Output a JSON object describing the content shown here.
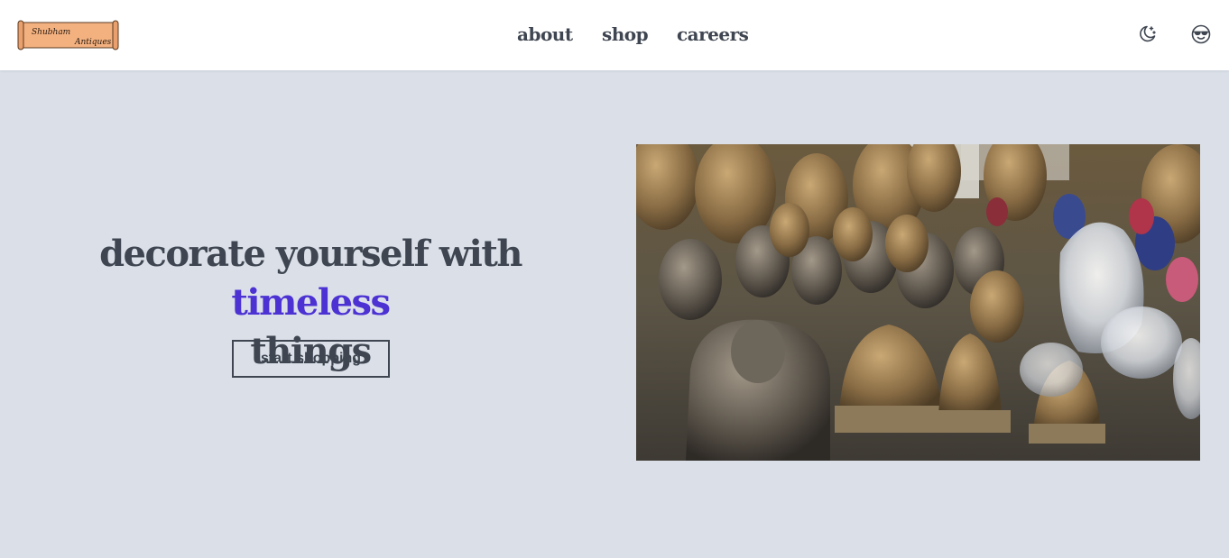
{
  "header": {
    "logo": {
      "line1": "Shubham",
      "line2": "Antiques",
      "icon": "scroll-logo"
    },
    "nav": [
      {
        "label": "about"
      },
      {
        "label": "shop"
      },
      {
        "label": "careers"
      }
    ],
    "actions": {
      "theme_icon": "moon-stars-icon",
      "face_icon": "sunglasses-smiley-icon"
    }
  },
  "hero": {
    "headline_part1": "decorate yourself with ",
    "headline_accent": "timeless",
    "headline_part2": "things",
    "cta_label": "start shopping",
    "image_icon": "brass-ganesha-figurines-photo"
  },
  "colors": {
    "background": "#dbe0e8",
    "header": "#ffffff",
    "text": "#3f4651",
    "accent": "#4c32d3",
    "logo_scroll": "#f3b17f"
  }
}
